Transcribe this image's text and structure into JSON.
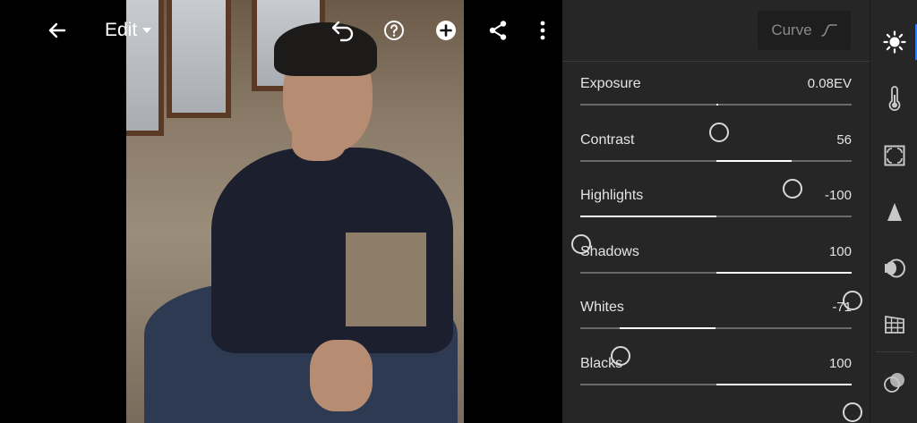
{
  "toolbar": {
    "edit_label": "Edit",
    "icons": [
      "back-arrow-icon",
      "undo-icon",
      "help-icon",
      "add-icon",
      "share-icon",
      "more-icon"
    ]
  },
  "panel": {
    "curve_label": "Curve",
    "sliders": [
      {
        "label": "Exposure",
        "value": "0.08EV",
        "numeric": 0.08,
        "min": -5,
        "max": 5
      },
      {
        "label": "Contrast",
        "value": "56",
        "numeric": 56,
        "min": -100,
        "max": 100
      },
      {
        "label": "Highlights",
        "value": "-100",
        "numeric": -100,
        "min": -100,
        "max": 100
      },
      {
        "label": "Shadows",
        "value": "100",
        "numeric": 100,
        "min": -100,
        "max": 100
      },
      {
        "label": "Whites",
        "value": "-71",
        "numeric": -71,
        "min": -100,
        "max": 100
      },
      {
        "label": "Blacks",
        "value": "100",
        "numeric": 100,
        "min": -100,
        "max": 100
      }
    ]
  },
  "rail": {
    "items": [
      "light-icon",
      "color-temperature-icon",
      "effects-icon",
      "detail-icon",
      "optics-icon",
      "geometry-icon",
      "presets-icon"
    ],
    "active": "light-icon"
  },
  "colors": {
    "accent": "#2f7bf5",
    "panel_bg": "#262626",
    "text": "#e4e4e4"
  }
}
